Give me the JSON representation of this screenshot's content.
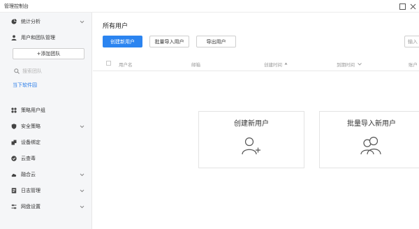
{
  "window": {
    "title": "管理控制台"
  },
  "sidebar": {
    "items": [
      {
        "id": "stats",
        "label": "统计分析",
        "icon": "chart-pie-icon",
        "has_chevron": true
      },
      {
        "id": "users-teams",
        "label": "用户和团队管理",
        "icon": "user-icon",
        "has_chevron": false
      }
    ],
    "add_team_label": "+添加团队",
    "team_search_placeholder": "搜索团队",
    "team_link": "当下软件园",
    "bottom_items": [
      {
        "id": "policy-groups",
        "label": "策略用户组",
        "icon": "grid-icon",
        "has_chevron": false
      },
      {
        "id": "security",
        "label": "安全策略",
        "icon": "shield-icon",
        "has_chevron": true
      },
      {
        "id": "device-bind",
        "label": "设备绑定",
        "icon": "device-icon",
        "has_chevron": false
      },
      {
        "id": "antivirus",
        "label": "云查毒",
        "icon": "check-circle-icon",
        "has_chevron": false
      },
      {
        "id": "hybrid-cloud",
        "label": "融合云",
        "icon": "cloud-icon",
        "has_chevron": true
      },
      {
        "id": "logs",
        "label": "日志管理",
        "icon": "document-icon",
        "has_chevron": true
      },
      {
        "id": "disk-settings",
        "label": "网盘设置",
        "icon": "sliders-icon",
        "has_chevron": true
      }
    ]
  },
  "main": {
    "title": "所有用户",
    "buttons": {
      "create": "创建新用户",
      "import": "批量导入用户",
      "export": "导出用户"
    },
    "search_placeholder": "输入",
    "columns": {
      "username": "用户名",
      "email": "邮箱",
      "created": "创建时间",
      "expires": "到期时间",
      "account": "账户"
    },
    "cards": {
      "create": "创建新用户",
      "import": "批量导入新用户"
    }
  },
  "colors": {
    "primary": "#2b84f0",
    "link": "#2b7de9",
    "sidebar_bg": "#f5f6f8"
  }
}
